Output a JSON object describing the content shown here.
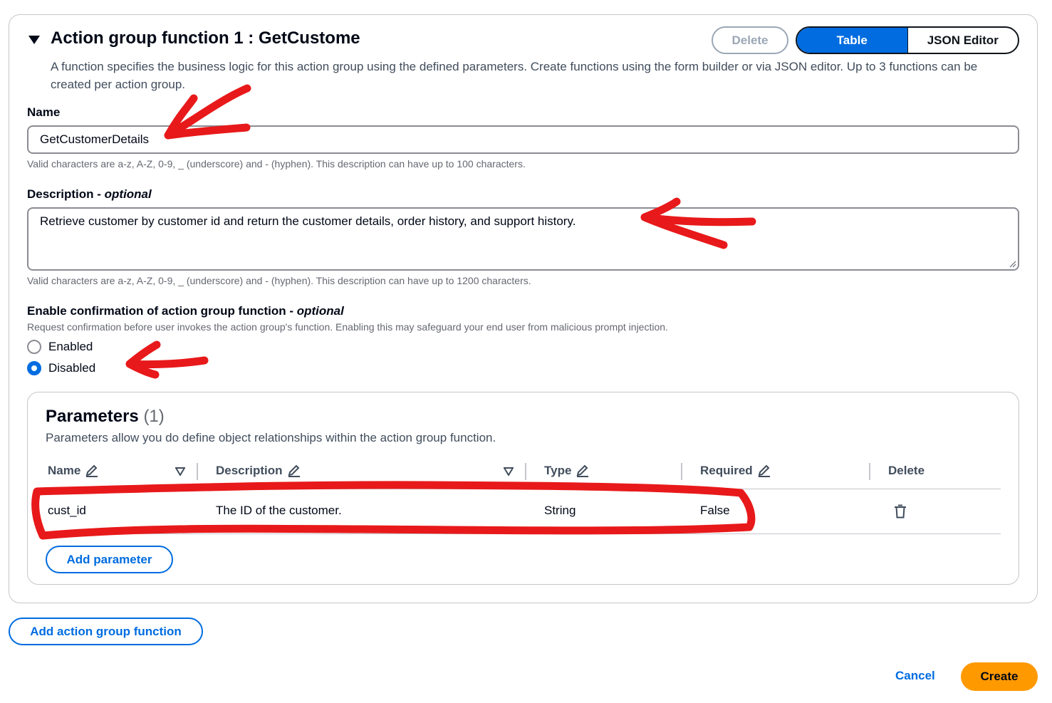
{
  "function": {
    "title": "Action group function 1 : GetCustome",
    "subtitle": "A function specifies the business logic for this action group using the defined parameters. Create functions using the form builder or via JSON editor. Up to 3 functions can be created per action group.",
    "delete_label": "Delete",
    "view_toggle": {
      "table_label": "Table",
      "json_label": "JSON Editor",
      "selected": "Table"
    }
  },
  "name_field": {
    "label": "Name",
    "value": "GetCustomerDetails",
    "hint": "Valid characters are a-z, A-Z, 0-9, _ (underscore) and - (hyphen). This description can have up to 100 characters."
  },
  "description_field": {
    "label": "Description",
    "optional": "optional",
    "value": "Retrieve customer by customer id and return the customer details, order history, and support history.",
    "hint": "Valid characters are a-z, A-Z, 0-9, _ (underscore) and - (hyphen). This description can have up to 1200 characters."
  },
  "confirmation": {
    "label": "Enable confirmation of action group function",
    "optional": "optional",
    "hint": "Request confirmation before user invokes the action group's function. Enabling this may safeguard your end user from malicious prompt injection.",
    "options": [
      "Enabled",
      "Disabled"
    ],
    "selected": "Disabled"
  },
  "parameters": {
    "title": "Parameters",
    "count": "(1)",
    "description": "Parameters allow you do define object relationships within the action group function.",
    "columns": [
      "Name",
      "Description",
      "Type",
      "Required",
      "Delete"
    ],
    "rows": [
      {
        "name": "cust_id",
        "description": "The ID of the customer.",
        "type": "String",
        "required": "False"
      }
    ],
    "add_label": "Add parameter"
  },
  "add_function_label": "Add action group function",
  "footer": {
    "cancel_label": "Cancel",
    "create_label": "Create"
  },
  "colors": {
    "primary": "#006ce0",
    "create": "#ff9900",
    "annotation": "#e8191a"
  }
}
